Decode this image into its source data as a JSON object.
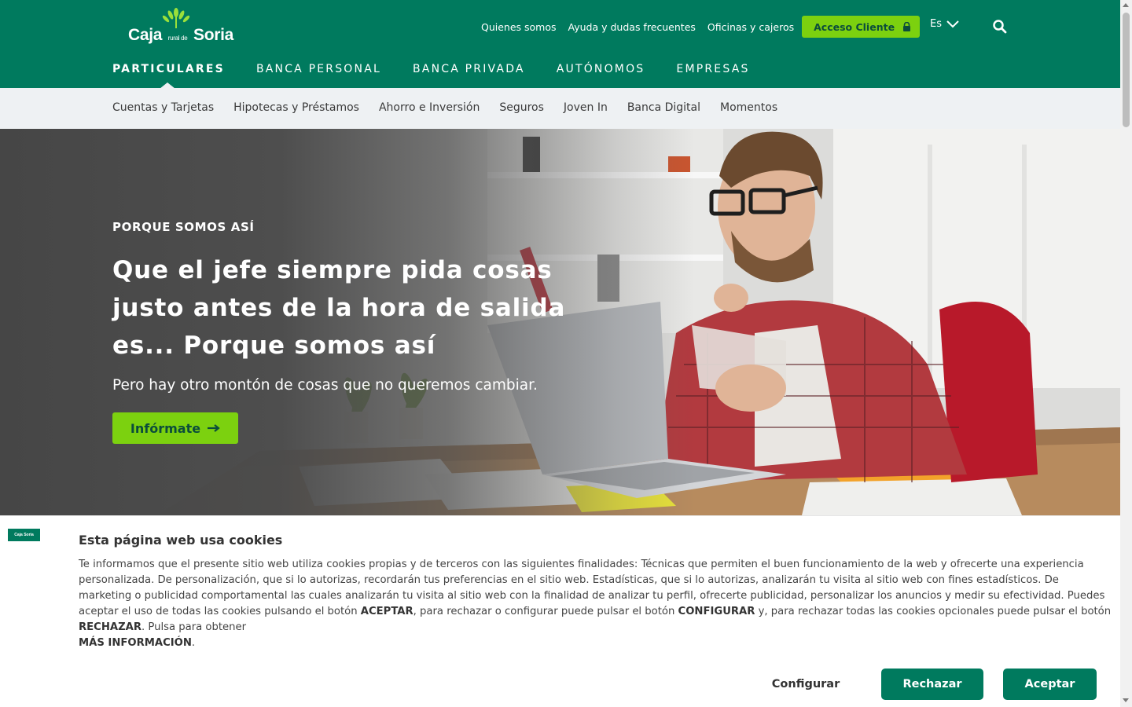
{
  "brand": {
    "logo_text_left": "Caja",
    "logo_text_mid": "rural de",
    "logo_text_right": "Soria",
    "primary_color": "#007a5e",
    "accent_color": "#7cd10f"
  },
  "utility_nav": {
    "links": [
      "Quienes somos",
      "Ayuda y dudas frecuentes",
      "Oficinas y cajeros"
    ],
    "login_label": "Acceso Cliente",
    "login_icon": "lock-icon",
    "language": "Es",
    "search_icon": "search-icon"
  },
  "main_nav": {
    "items": [
      "PARTICULARES",
      "BANCA PERSONAL",
      "BANCA PRIVADA",
      "AUTÓNOMOS",
      "EMPRESAS"
    ],
    "active": "PARTICULARES"
  },
  "sub_nav": {
    "items": [
      "Cuentas y Tarjetas",
      "Hipotecas y Préstamos",
      "Ahorro e Inversión",
      "Seguros",
      "Joven In",
      "Banca Digital",
      "Momentos"
    ]
  },
  "hero": {
    "eyebrow": "PORQUE SOMOS ASÍ",
    "headline": "Que el jefe siempre pida cosas justo antes de la hora de salida es... Porque somos así",
    "lead": "Pero hay otro montón de cosas que no queremos cambiar.",
    "cta_label": "Infórmate",
    "cta_icon": "arrow-right-icon"
  },
  "cookie_banner": {
    "logo_text": "Caja Soria",
    "title": "Esta página web usa cookies",
    "text_1": "Te informamos que el presente sitio web utiliza cookies propias y de terceros con las siguientes finalidades: Técnicas que permiten el buen funcionamiento de la web y ofrecerte una experiencia personalizada. De personalización, que si lo autorizas, recordarán tus preferencias en el sitio web. Estadísticas, que si lo autorizas, analizarán tu visita al sitio web con fines estadísticos. De marketing o publicidad comportamental las cuales analizarán tu visita al sitio web con la finalidad de analizar tu perfil, ofrecerte publicidad, personalizar los anuncios y medir su efectividad. Puedes aceptar el uso de todas las cookies pulsando el botón ",
    "accept_word": "ACEPTAR",
    "text_2": ", para rechazar o configurar puede pulsar el botón ",
    "config_word": "CONFIGURAR",
    "text_3": " y, para rechazar todas las cookies opcionales puede pulsar el botón ",
    "reject_word": "RECHAZAR",
    "text_4": ". Pulsa para obtener ",
    "more_info": "MÁS INFORMACIÓN",
    "text_5": ".",
    "configure_label": "Configurar",
    "reject_label": "Rechazar",
    "accept_label": "Aceptar"
  }
}
